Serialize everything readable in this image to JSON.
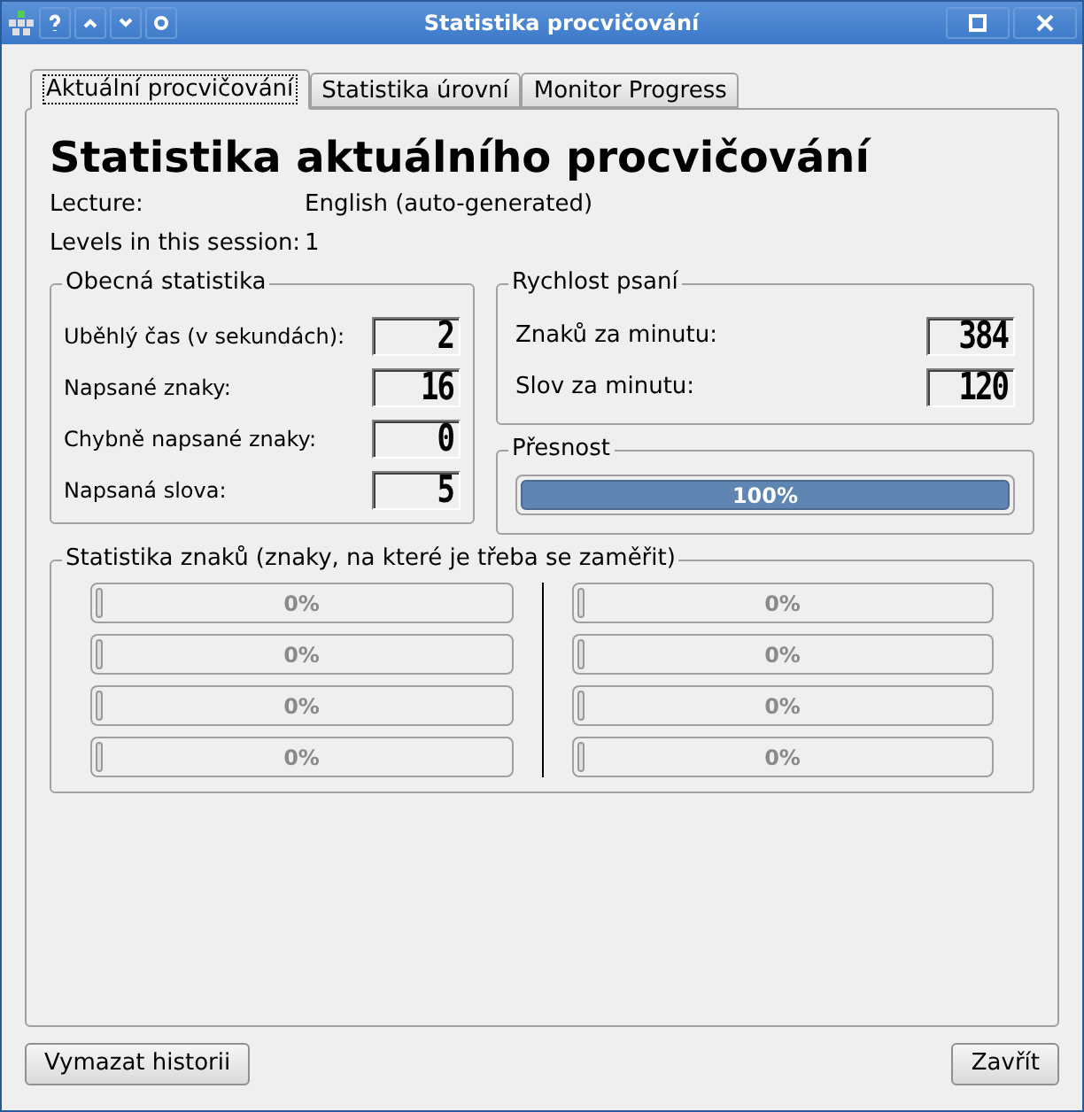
{
  "window": {
    "title": "Statistika procvičování"
  },
  "tabs": [
    {
      "label": "Aktuální procvičování",
      "selected": true
    },
    {
      "label": "Statistika úrovní",
      "selected": false
    },
    {
      "label": "Monitor Progress",
      "selected": false
    }
  ],
  "heading": "Statistika aktuálního procvičování",
  "info": [
    {
      "label": "Lecture:",
      "value": "English (auto-generated)"
    },
    {
      "label": "Levels in this session:",
      "value": "1"
    }
  ],
  "general": {
    "title": "Obecná statistika",
    "rows": [
      {
        "label": "Uběhlý čas (v sekundách):",
        "value": "2"
      },
      {
        "label": "Napsané znaky:",
        "value": "16"
      },
      {
        "label": "Chybně napsané znaky:",
        "value": "0"
      },
      {
        "label": "Napsaná slova:",
        "value": "5"
      }
    ]
  },
  "speed": {
    "title": "Rychlost psaní",
    "rows": [
      {
        "label": "Znaků za minutu:",
        "value": "384"
      },
      {
        "label": "Slov za minutu:",
        "value": "120"
      }
    ]
  },
  "accuracy": {
    "title": "Přesnost",
    "level": 1,
    "reading": "100%",
    "disabled": false
  },
  "char_stats": {
    "title": "Statistika znaků (znaky, na které je třeba se zaměřit)",
    "columns": [
      [
        {
          "level": 0,
          "reading": "0%",
          "disabled": true
        },
        {
          "level": 0,
          "reading": "0%",
          "disabled": true
        },
        {
          "level": 0,
          "reading": "0%",
          "disabled": true
        },
        {
          "level": 0,
          "reading": "0%",
          "disabled": true
        }
      ],
      [
        {
          "level": 0,
          "reading": "0%",
          "disabled": true
        },
        {
          "level": 0,
          "reading": "0%",
          "disabled": true
        },
        {
          "level": 0,
          "reading": "0%",
          "disabled": true
        },
        {
          "level": 0,
          "reading": "0%",
          "disabled": true
        }
      ]
    ]
  },
  "buttons": [
    {
      "label": "Vymazat historii"
    },
    {
      "label": "Zavřít"
    }
  ]
}
